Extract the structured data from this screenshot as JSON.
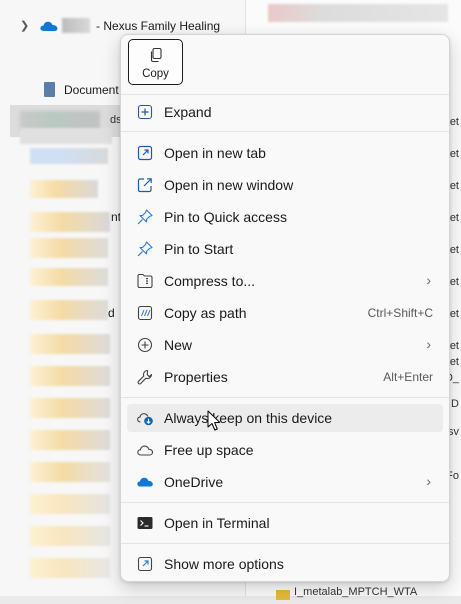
{
  "background": {
    "nav": {
      "onedrive_label": "- Nexus Family Healing",
      "documents_label": "Document",
      "selected_fragment": "ds"
    },
    "fragments": [
      "nt",
      "d"
    ],
    "edge_fragments": [
      "et",
      "et",
      "et",
      "et",
      "et",
      "et",
      "et",
      "et",
      "et",
      "D_",
      "D",
      "sv",
      "Fo"
    ],
    "bottom_text": "I_metalab_MPTCH_WTA"
  },
  "menu": {
    "copy_label": "Copy",
    "items": [
      {
        "id": "expand",
        "label": "Expand",
        "icon": "expand-icon"
      },
      {
        "id": "open-new-tab",
        "label": "Open in new tab",
        "icon": "new-tab-icon"
      },
      {
        "id": "open-new-window",
        "label": "Open in new window",
        "icon": "new-window-icon"
      },
      {
        "id": "pin-quick-access",
        "label": "Pin to Quick access",
        "icon": "pin-icon"
      },
      {
        "id": "pin-start",
        "label": "Pin to Start",
        "icon": "pin-icon"
      },
      {
        "id": "compress",
        "label": "Compress to...",
        "icon": "zip-icon",
        "submenu": true
      },
      {
        "id": "copy-as-path",
        "label": "Copy as path",
        "icon": "copy-path-icon",
        "shortcut": "Ctrl+Shift+C"
      },
      {
        "id": "new",
        "label": "New",
        "icon": "add-icon",
        "submenu": true
      },
      {
        "id": "properties",
        "label": "Properties",
        "icon": "wrench-icon",
        "shortcut": "Alt+Enter"
      },
      {
        "id": "always-keep",
        "label": "Always keep on this device",
        "icon": "cloud-download-icon"
      },
      {
        "id": "free-up-space",
        "label": "Free up space",
        "icon": "cloud-outline-icon"
      },
      {
        "id": "onedrive",
        "label": "OneDrive",
        "icon": "onedrive-icon",
        "submenu": true
      },
      {
        "id": "open-terminal",
        "label": "Open in Terminal",
        "icon": "terminal-icon"
      },
      {
        "id": "show-more",
        "label": "Show more options",
        "icon": "more-options-icon"
      }
    ],
    "submenu_arrow": "›"
  },
  "colors": {
    "accent": "#0067c0",
    "onedrive": "#0f78d4"
  }
}
